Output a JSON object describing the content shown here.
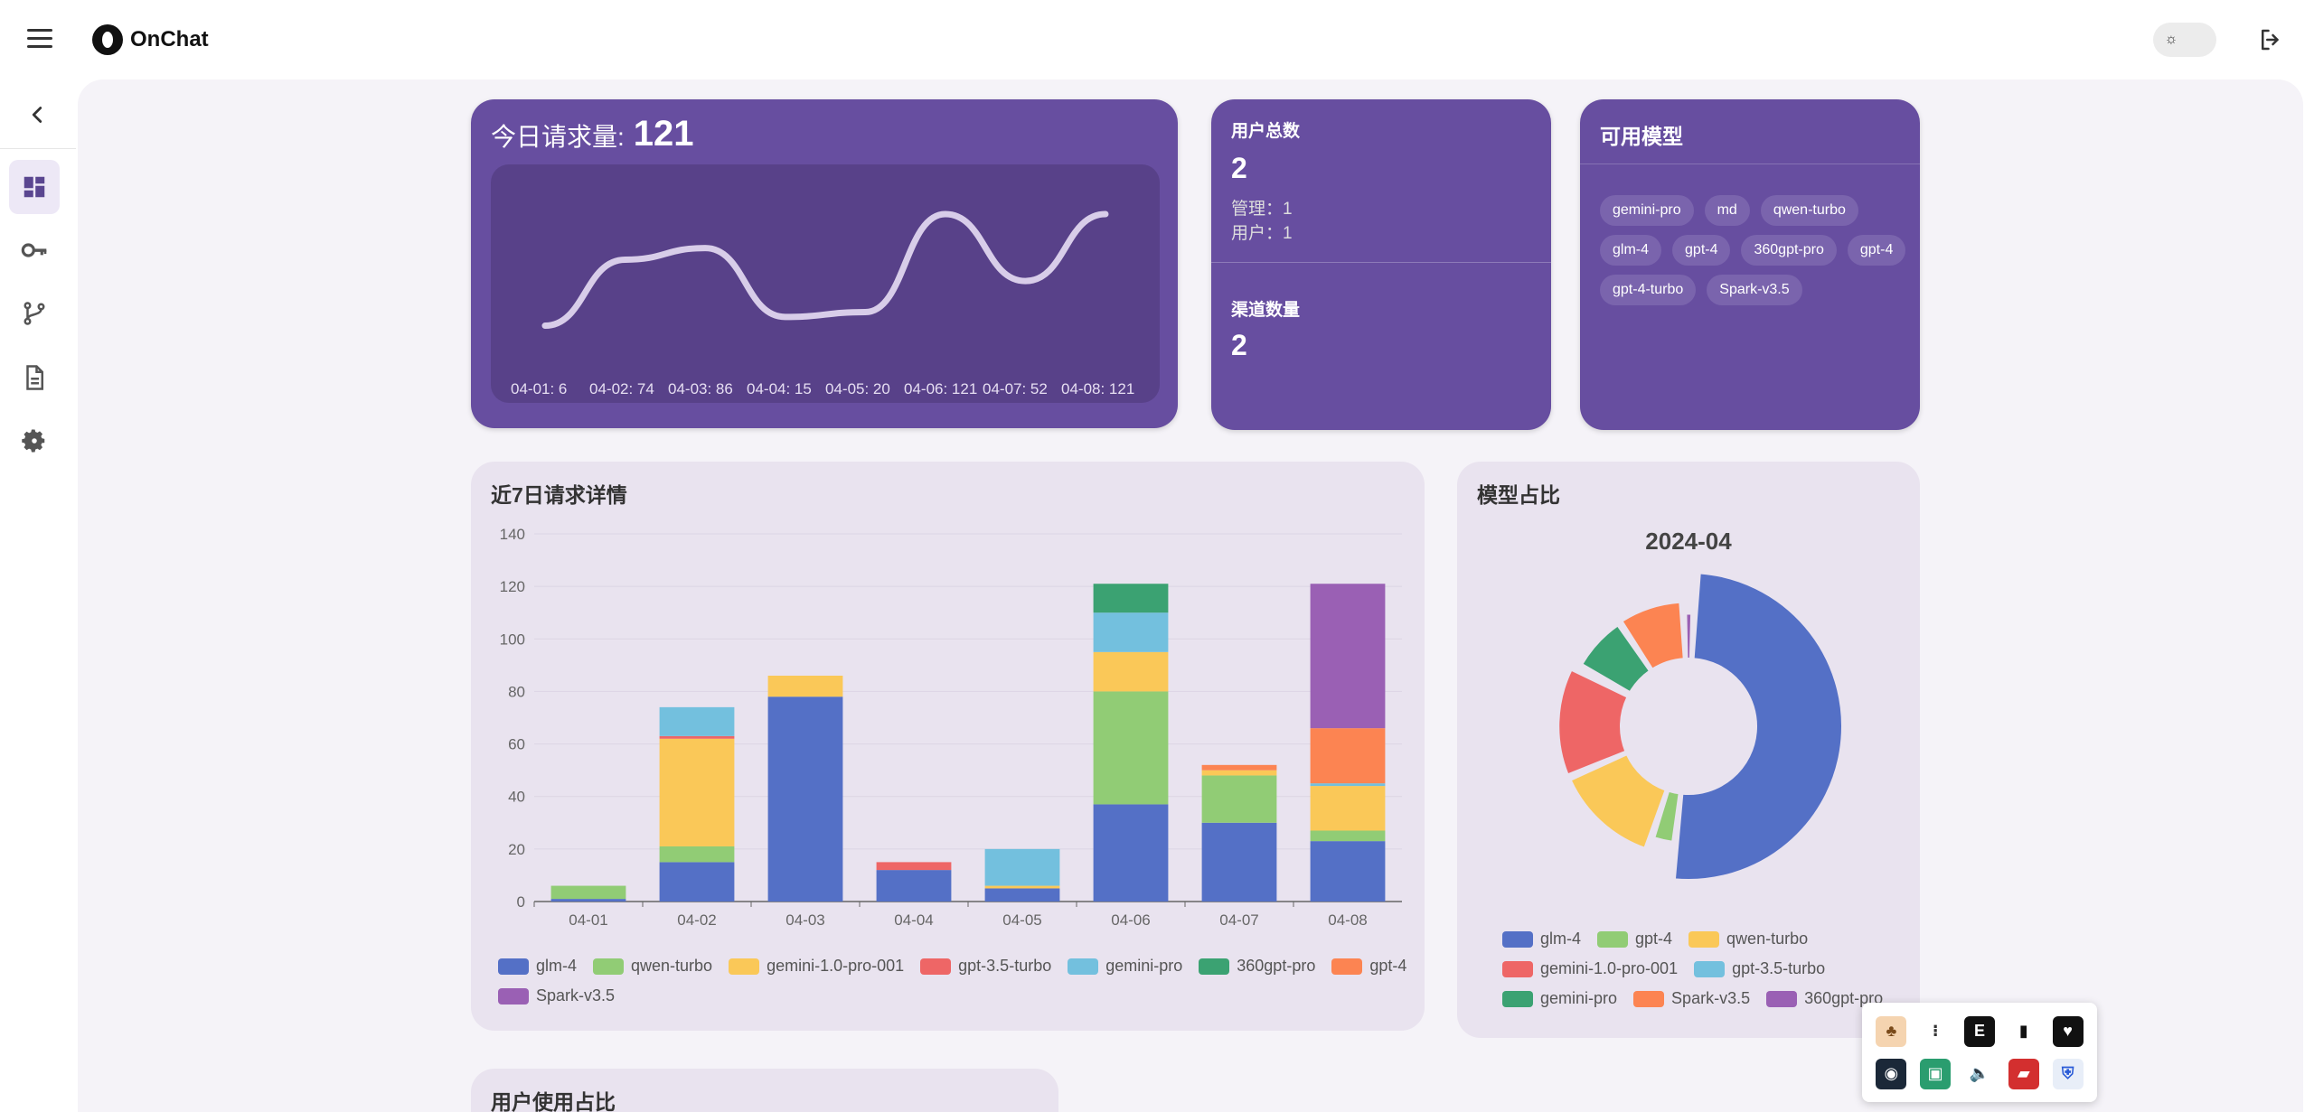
{
  "app": {
    "name": "OnChat"
  },
  "header": {
    "theme_icon": "sun-icon",
    "logout_icon": "logout-icon"
  },
  "sidebar": {
    "items": [
      {
        "name": "dashboard",
        "icon": "dashboard-icon",
        "active": true
      },
      {
        "name": "keys",
        "icon": "key-icon",
        "active": false
      },
      {
        "name": "channels",
        "icon": "branch-icon",
        "active": false
      },
      {
        "name": "logs",
        "icon": "document-icon",
        "active": false
      },
      {
        "name": "settings",
        "icon": "gear-icon",
        "active": false
      }
    ]
  },
  "today": {
    "label": "今日请求量:",
    "value": "121",
    "points": [
      {
        "label": "04-01: 6",
        "value": 6
      },
      {
        "label": "04-02: 74",
        "value": 74
      },
      {
        "label": "04-03: 86",
        "value": 86
      },
      {
        "label": "04-04: 15",
        "value": 15
      },
      {
        "label": "04-05: 20",
        "value": 20
      },
      {
        "label": "04-06: 121",
        "value": 121
      },
      {
        "label": "04-07: 52",
        "value": 52
      },
      {
        "label": "04-08: 121",
        "value": 121
      }
    ]
  },
  "users": {
    "label": "用户总数",
    "value": "2",
    "admin": "管理：1",
    "user": "用户：1"
  },
  "channels": {
    "label": "渠道数量",
    "value": "2"
  },
  "models": {
    "title": "可用模型",
    "chips": [
      "gemini-pro",
      "md",
      "qwen-turbo",
      "glm-4",
      "gpt-4",
      "360gpt-pro",
      "gpt-4",
      "gpt-4-turbo",
      "Spark-v3.5"
    ]
  },
  "requests": {
    "title": "近7日请求详情"
  },
  "model_share": {
    "title": "模型占比"
  },
  "user_share": {
    "title": "用户使用占比"
  },
  "colors": {
    "purple": "#674ea0",
    "glm-4": "#5470c6",
    "qwen-turbo": "#91cc75",
    "gemini-1.0-pro-001": "#fac858",
    "gpt-3.5-turbo": "#ee6666",
    "gemini-pro": "#73c0de",
    "360gpt-pro": "#3ba272",
    "gpt-4": "#fc8452",
    "Spark-v3.5": "#9a60b4"
  },
  "chart_data": [
    {
      "type": "bar",
      "stacked": true,
      "categories": [
        "04-01",
        "04-02",
        "04-03",
        "04-04",
        "04-05",
        "04-06",
        "04-07",
        "04-08"
      ],
      "ylim": [
        0,
        140
      ],
      "yticks": [
        0,
        20,
        40,
        60,
        80,
        100,
        120,
        140
      ],
      "grid": true,
      "legend": "bottom",
      "series": [
        {
          "name": "glm-4",
          "color": "#5470c6",
          "values": [
            1,
            15,
            78,
            12,
            5,
            37,
            30,
            23
          ]
        },
        {
          "name": "qwen-turbo",
          "color": "#91cc75",
          "values": [
            5,
            6,
            0,
            0,
            0,
            43,
            18,
            4
          ]
        },
        {
          "name": "gemini-1.0-pro-001",
          "color": "#fac858",
          "values": [
            0,
            41,
            8,
            0,
            1,
            15,
            2,
            17
          ]
        },
        {
          "name": "gpt-3.5-turbo",
          "color": "#ee6666",
          "values": [
            0,
            1,
            0,
            3,
            0,
            0,
            0,
            0
          ]
        },
        {
          "name": "gemini-pro",
          "color": "#73c0de",
          "values": [
            0,
            11,
            0,
            0,
            14,
            15,
            0,
            1
          ]
        },
        {
          "name": "360gpt-pro",
          "color": "#3ba272",
          "values": [
            0,
            0,
            0,
            0,
            0,
            11,
            0,
            0
          ]
        },
        {
          "name": "gpt-4",
          "color": "#fc8452",
          "values": [
            0,
            0,
            0,
            0,
            0,
            0,
            2,
            21
          ]
        },
        {
          "name": "Spark-v3.5",
          "color": "#9a60b4",
          "values": [
            0,
            0,
            0,
            0,
            0,
            0,
            0,
            55
          ]
        }
      ]
    },
    {
      "type": "pie",
      "title": "2024-04",
      "legend": "bottom",
      "slices": [
        {
          "name": "glm-4",
          "color": "#5470c6",
          "value": 201
        },
        {
          "name": "gpt-4",
          "color": "#91cc75",
          "value": 13
        },
        {
          "name": "qwen-turbo",
          "color": "#fac858",
          "value": 53
        },
        {
          "name": "gemini-1.0-pro-001",
          "color": "#ee6666",
          "value": 55
        },
        {
          "name": "gpt-3.5-turbo",
          "color": "#73c0de",
          "value": 2
        },
        {
          "name": "gemini-pro",
          "color": "#3ba272",
          "value": 30
        },
        {
          "name": "Spark-v3.5",
          "color": "#fc8452",
          "value": 34
        },
        {
          "name": "360gpt-pro",
          "color": "#9a60b4",
          "value": 6
        }
      ]
    }
  ],
  "tray": {
    "icons": [
      "app-icon-1",
      "grid-icon",
      "epic-games-icon",
      "bookmark-icon",
      "activity-icon",
      "steam-icon",
      "terminal-icon",
      "speaker-icon",
      "app-icon-red",
      "shield-icon"
    ]
  }
}
